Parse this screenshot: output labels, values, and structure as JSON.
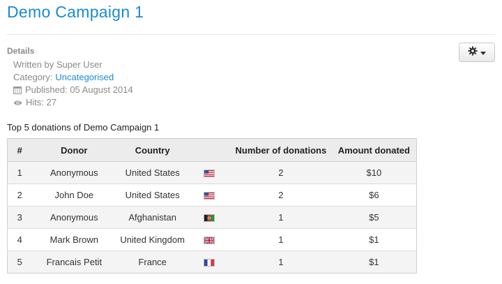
{
  "page": {
    "title": "Demo Campaign 1"
  },
  "details": {
    "heading": "Details",
    "written_by": "Written by Super User",
    "category_label": "Category:",
    "category_link": "Uncategorised",
    "published": "Published: 05 August 2014",
    "hits": "Hits: 27"
  },
  "tools": {
    "icon": "gear-icon",
    "caret": "caret-down-icon"
  },
  "donations": {
    "caption": "Top 5 donations of Demo Campaign 1",
    "columns": [
      "#",
      "Donor",
      "Country",
      "",
      "Number of donations",
      "Amount donated"
    ],
    "rows": [
      {
        "rank": "1",
        "donor": "Anonymous",
        "country": "United States",
        "flag": "us-flag-icon",
        "count": "2",
        "amount": "$10"
      },
      {
        "rank": "2",
        "donor": "John Doe",
        "country": "United States",
        "flag": "us-flag-icon",
        "count": "2",
        "amount": "$6"
      },
      {
        "rank": "3",
        "donor": "Anonymous",
        "country": "Afghanistan",
        "flag": "af-flag-icon",
        "count": "1",
        "amount": "$5"
      },
      {
        "rank": "4",
        "donor": "Mark Brown",
        "country": "United Kingdom",
        "flag": "gb-flag-icon",
        "count": "1",
        "amount": "$1"
      },
      {
        "rank": "5",
        "donor": "Francais Petit",
        "country": "France",
        "flag": "fr-flag-icon",
        "count": "1",
        "amount": "$1"
      }
    ]
  },
  "colors": {
    "accent": "#1a8ad6",
    "muted": "#8a8a8a",
    "header_bg": "#ececec",
    "row_alt": "#f4f4f4"
  }
}
